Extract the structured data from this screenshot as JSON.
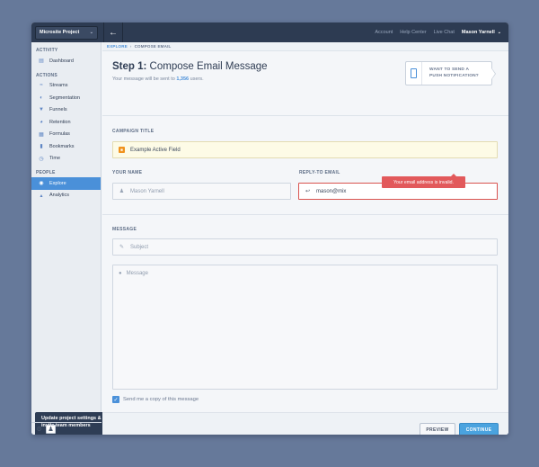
{
  "topbar": {
    "project": "Microsite Project",
    "links": [
      "Account",
      "Help Center",
      "Live Chat"
    ],
    "user": "Mason Yarnell"
  },
  "sidebar": {
    "sections": [
      {
        "title": "ACTIVITY",
        "items": [
          {
            "label": "Dashboard",
            "icon": "dashboard-icon"
          }
        ]
      },
      {
        "title": "ACTIONS",
        "items": [
          {
            "label": "Streams",
            "icon": "streams-icon"
          },
          {
            "label": "Segmentation",
            "icon": "segmentation-icon"
          },
          {
            "label": "Funnels",
            "icon": "funnels-icon"
          },
          {
            "label": "Retention",
            "icon": "retention-icon"
          },
          {
            "label": "Formulas",
            "icon": "formulas-icon"
          },
          {
            "label": "Bookmarks",
            "icon": "bookmarks-icon"
          },
          {
            "label": "Time",
            "icon": "time-icon"
          }
        ]
      },
      {
        "title": "PEOPLE",
        "items": [
          {
            "label": "Explore",
            "icon": "explore-icon",
            "active": true
          },
          {
            "label": "Analytics",
            "icon": "analytics-icon"
          }
        ]
      }
    ],
    "tooltip": "Update project settings & invite team members"
  },
  "breadcrumb": {
    "link": "EXPLORE",
    "current": "COMPOSE EMAIL"
  },
  "header": {
    "step": "Step 1:",
    "title": "Compose Email Message",
    "sub_prefix": "Your message will be sent to",
    "sub_count": "1,356",
    "sub_suffix": "users.",
    "push_line1": "WANT TO SEND A",
    "push_line2": "PUSH NOTIFICATION?"
  },
  "form": {
    "campaign_label": "CAMPAIGN TITLE",
    "campaign_value": "Example Active Field",
    "name_label": "YOUR NAME",
    "name_placeholder": "Mason Yarnell",
    "reply_label": "REPLY-TO EMAIL",
    "reply_value": "mason@mix",
    "error_message": "Your email address is invalid.",
    "message_label": "MESSAGE",
    "subject_placeholder": "Subject",
    "message_placeholder": "Message",
    "copy_label": "Send me a copy of this message",
    "copy_checked": true
  },
  "buttons": {
    "preview": "PREVIEW",
    "continue": "CONTINUE"
  },
  "colors": {
    "accent": "#4a90d9",
    "error": "#e2595b",
    "active_field": "#fdfbe6",
    "topbar": "#2d3b52"
  }
}
